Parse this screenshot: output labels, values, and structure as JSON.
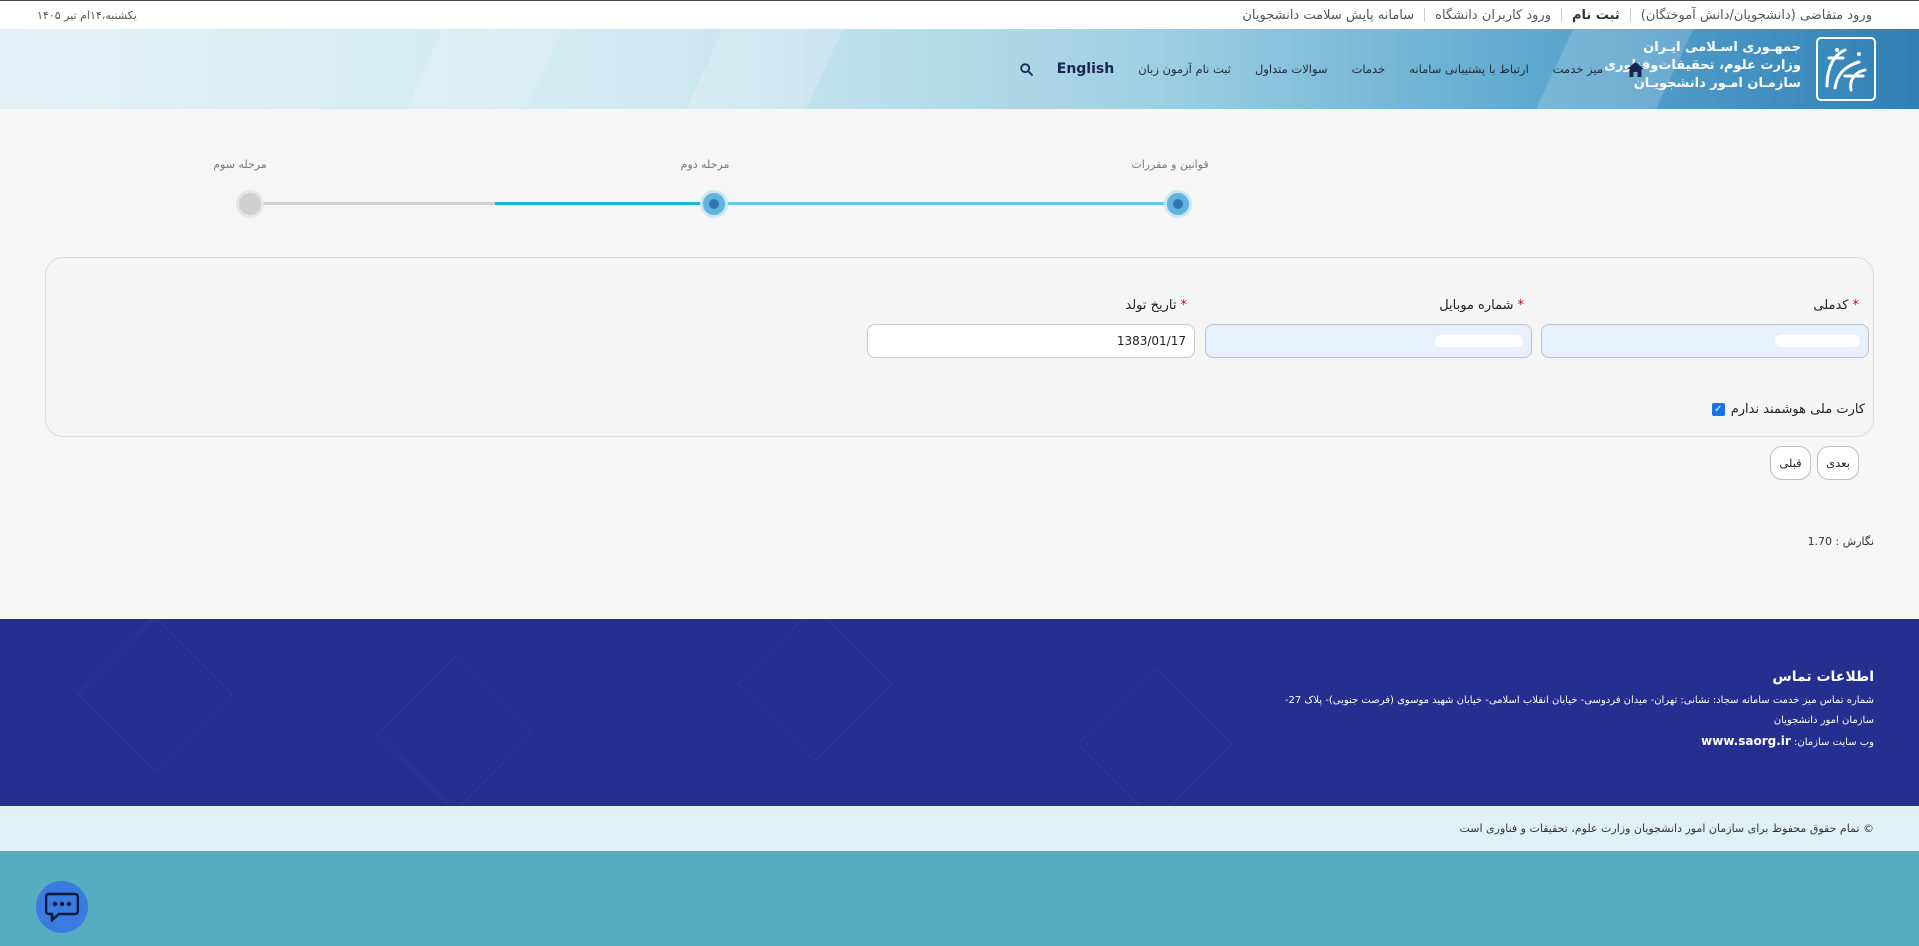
{
  "topbar": {
    "links": [
      {
        "label": "ورود متقاضی (دانشجویان/دانش آموختگان)",
        "bold": false
      },
      {
        "label": "ثبت نام",
        "bold": true
      },
      {
        "label": "ورود کاربران دانشگاه",
        "bold": false
      },
      {
        "label": "سامانه پایش سلامت دانشجویان",
        "bold": false
      }
    ],
    "date": "یکشنبه،۱۴ام تیر ۱۴۰۵"
  },
  "header": {
    "org_line1": "جمهـوری اسـلامی ایـران",
    "org_line2": "وزارت علوم، تحقیقات‌وفناوری",
    "org_line3": "سازمـان امـور دانشجویـان",
    "nav": [
      "میز خدمت",
      "ارتباط با پشتیبانی سامانه",
      "خدمات",
      "سوالات متداول",
      "ثبت نام آزمون زبان"
    ],
    "english_label": "English",
    "colors": {
      "gradient_end": "#2f7fb6",
      "nav_text": "#1f2a3a"
    }
  },
  "stepper": {
    "steps": [
      {
        "label": "قوانین و مقررات",
        "state": "done"
      },
      {
        "label": "مرحله دوم",
        "state": "current"
      },
      {
        "label": "مرحله سوم",
        "state": "todo"
      }
    ],
    "accent": "#1bb3d6"
  },
  "form": {
    "national_code_label": "کدملی",
    "mobile_label": "شماره موبایل",
    "birth_label": "تاریخ تولد",
    "birth_value": "1383/01/17",
    "smartcard_label": "کارت ملی هوشمند ندارم",
    "smartcard_checked": true,
    "next_label": "بعدی",
    "prev_label": "قبلی",
    "version": "نگارش : 1.70"
  },
  "footer": {
    "title": "اطلاعات تماس",
    "address": "شماره تماس میز خدمت سامانه سجاد: نشانی: تهران- میدان فردوسی- خیابان انقلاب اسلامی- خیابان شهید موسوی (فرصت جنوبی)- پلاک 27-",
    "org": "سازمان امور دانشجویان",
    "website_label": "وب سایت سازمان:",
    "website": "www.saorg.ir",
    "copyright": "© تمام حقوق محفوظ برای سازمان امور دانشجویان وزارت علوم، تحقیقات و فناوری است",
    "colors": {
      "footer_bg": "#262e90",
      "copy_bg": "#dff1f4",
      "bottom_bg": "#56adbf"
    }
  }
}
